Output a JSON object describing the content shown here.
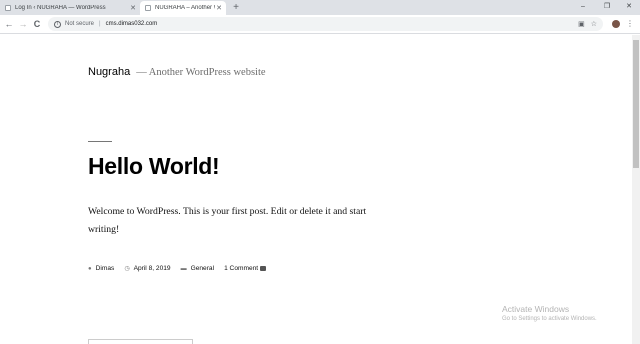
{
  "browser": {
    "tabs": [
      {
        "title": "Log In ‹ NUGRAHA — WordPress",
        "active": false
      },
      {
        "title": "NUGRAHA – Another WordPress",
        "active": true
      }
    ],
    "new_tab": "+",
    "window_controls": {
      "minimize": "–",
      "restore": "❐",
      "close": "✕"
    },
    "nav": {
      "back": "←",
      "forward": "→",
      "reload": "C"
    },
    "address": {
      "security": "Not secure",
      "url": "cms.dimas032.com"
    },
    "toolbar_icons": [
      "translate-icon",
      "star-icon"
    ]
  },
  "site": {
    "title": "Nugraha",
    "separator": "—",
    "description": "Another WordPress website"
  },
  "post": {
    "title": "Hello World!",
    "content": "Welcome to WordPress. This is your first post. Edit or delete it and start writing!",
    "meta": {
      "author": "Dimas",
      "date": "April 8, 2019",
      "category": "General",
      "comments": "1 Comment"
    }
  },
  "watermark": {
    "title": "Activate Windows",
    "subtitle": "Go to Settings to activate Windows."
  }
}
